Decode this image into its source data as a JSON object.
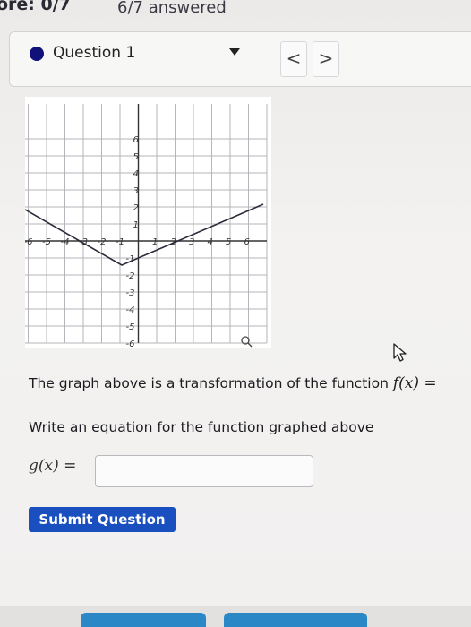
{
  "header": {
    "score_text": "ore: 0/7",
    "answered_text": "6/7 answered"
  },
  "question": {
    "label": "Question 1",
    "prev_label": "<",
    "next_label": ">",
    "accent_color": "#11117a"
  },
  "graph": {
    "x_ticks": [
      "-6",
      "-5",
      "-4",
      "-3",
      "-2",
      "-1",
      "1",
      "2",
      "3",
      "4",
      "5",
      "6"
    ],
    "y_ticks_pos": [
      "6",
      "5",
      "4",
      "3",
      "2",
      "1"
    ],
    "y_ticks_neg": [
      "-1",
      "-2",
      "-3",
      "-4",
      "-5",
      "-6"
    ],
    "line_color": "#2b2b3a",
    "magnifier_icon": "magnifier-icon"
  },
  "problem": {
    "text": "The graph above is a transformation of the function ",
    "function_expr": "f(x) =",
    "prompt": "Write an equation for the function graphed above",
    "answer_label": "g(x) =",
    "answer_value": ""
  },
  "submit": {
    "label": "Submit Question",
    "color": "#1a4fbf"
  }
}
